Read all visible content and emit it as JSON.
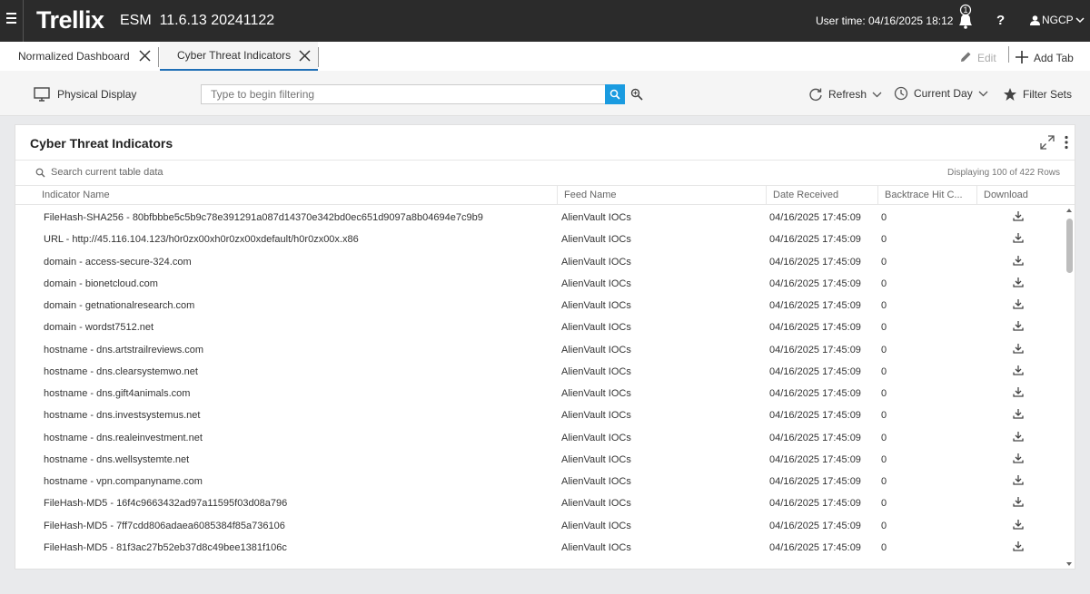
{
  "topbar": {
    "brand": "Trellix",
    "product": "ESM  11.6.13 20241122",
    "user_time": "User time: 04/16/2025 18:12",
    "notification_count": "1",
    "help": "?",
    "user": "NGCP"
  },
  "tabs": [
    {
      "label": "Normalized Dashboard"
    },
    {
      "label": "Cyber Threat Indicators"
    }
  ],
  "tab_actions": {
    "edit": "Edit",
    "add_tab": "Add Tab"
  },
  "toolbar": {
    "physical_display": "Physical Display",
    "filter_placeholder": "Type to begin filtering",
    "refresh": "Refresh",
    "time_range": "Current Day",
    "filter_sets": "Filter Sets"
  },
  "panel": {
    "title": "Cyber Threat Indicators",
    "search_placeholder": "Search current table data",
    "row_count": "Displaying 100 of 422 Rows",
    "columns": [
      "Indicator Name",
      "Feed Name",
      "Date Received",
      "Backtrace Hit C...",
      "Download"
    ],
    "rows": [
      {
        "indicator": "FileHash-SHA256 - 80bfbbbe5c5b9c78e391291a087d14370e342bd0ec651d9097a8b04694e7c9b9",
        "feed": "AlienVault IOCs",
        "date": "04/16/2025 17:45:09",
        "hits": "0"
      },
      {
        "indicator": "URL - http://45.116.104.123/h0r0zx00xh0r0zx00xdefault/h0r0zx00x.x86",
        "feed": "AlienVault IOCs",
        "date": "04/16/2025 17:45:09",
        "hits": "0"
      },
      {
        "indicator": "domain - access-secure-324.com",
        "feed": "AlienVault IOCs",
        "date": "04/16/2025 17:45:09",
        "hits": "0"
      },
      {
        "indicator": "domain - bionetcloud.com",
        "feed": "AlienVault IOCs",
        "date": "04/16/2025 17:45:09",
        "hits": "0"
      },
      {
        "indicator": "domain - getnationalresearch.com",
        "feed": "AlienVault IOCs",
        "date": "04/16/2025 17:45:09",
        "hits": "0"
      },
      {
        "indicator": "domain - wordst7512.net",
        "feed": "AlienVault IOCs",
        "date": "04/16/2025 17:45:09",
        "hits": "0"
      },
      {
        "indicator": "hostname - dns.artstrailreviews.com",
        "feed": "AlienVault IOCs",
        "date": "04/16/2025 17:45:09",
        "hits": "0"
      },
      {
        "indicator": "hostname - dns.clearsystemwo.net",
        "feed": "AlienVault IOCs",
        "date": "04/16/2025 17:45:09",
        "hits": "0"
      },
      {
        "indicator": "hostname - dns.gift4animals.com",
        "feed": "AlienVault IOCs",
        "date": "04/16/2025 17:45:09",
        "hits": "0"
      },
      {
        "indicator": "hostname - dns.investsystemus.net",
        "feed": "AlienVault IOCs",
        "date": "04/16/2025 17:45:09",
        "hits": "0"
      },
      {
        "indicator": "hostname - dns.realeinvestment.net",
        "feed": "AlienVault IOCs",
        "date": "04/16/2025 17:45:09",
        "hits": "0"
      },
      {
        "indicator": "hostname - dns.wellsystemte.net",
        "feed": "AlienVault IOCs",
        "date": "04/16/2025 17:45:09",
        "hits": "0"
      },
      {
        "indicator": "hostname - vpn.companyname.com",
        "feed": "AlienVault IOCs",
        "date": "04/16/2025 17:45:09",
        "hits": "0"
      },
      {
        "indicator": "FileHash-MD5 - 16f4c9663432ad97a11595f03d08a796",
        "feed": "AlienVault IOCs",
        "date": "04/16/2025 17:45:09",
        "hits": "0"
      },
      {
        "indicator": "FileHash-MD5 - 7ff7cdd806adaea6085384f85a736106",
        "feed": "AlienVault IOCs",
        "date": "04/16/2025 17:45:09",
        "hits": "0"
      },
      {
        "indicator": "FileHash-MD5 - 81f3ac27b52eb37d8c49bee1381f106c",
        "feed": "AlienVault IOCs",
        "date": "04/16/2025 17:45:09",
        "hits": "0"
      }
    ]
  },
  "colors": {
    "topbar": "#2b2b2b",
    "accent": "#1a9be0",
    "tab_underline": "#1f6fb6"
  },
  "icons": [
    "hamburger-icon",
    "bell-icon",
    "user-icon",
    "close-icon",
    "pencil-icon",
    "plus-icon",
    "monitor-icon",
    "search-icon",
    "refresh-icon",
    "clock-icon",
    "star-icon",
    "expand-icon",
    "more-vertical-icon",
    "download-icon"
  ]
}
